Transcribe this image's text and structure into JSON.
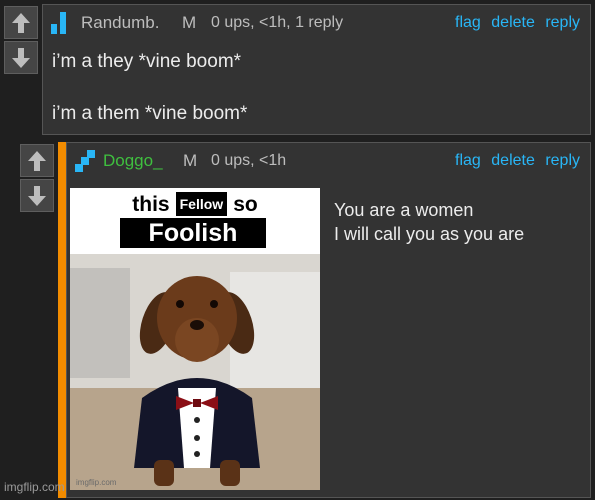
{
  "comments": [
    {
      "username": "Randumb.",
      "badge": "M",
      "meta": "0 ups, <1h, 1 reply",
      "actions": {
        "flag": "flag",
        "delete": "delete",
        "reply": "reply"
      },
      "lines": [
        "i’m a they *vine boom*",
        "i’m a them *vine boom*"
      ],
      "avatar_icon": "bar-chart-icon",
      "name_color": "#bdbdbd"
    },
    {
      "username": "Doggo_",
      "badge": "M",
      "meta": "0 ups, <1h",
      "actions": {
        "flag": "flag",
        "delete": "delete",
        "reply": "reply"
      },
      "lines": [
        "You are a women",
        "I will call you as you are"
      ],
      "avatar_icon": "diagonal-pixel-icon",
      "name_color": "#3fbf3f",
      "meme": {
        "top_word1": "this",
        "box_word": "Fellow",
        "top_word2": "so",
        "bottom_word": "Foolish",
        "watermark": "imgflip.com"
      }
    }
  ],
  "colors": {
    "background": "#1f1f1f",
    "panel": "#333333",
    "link": "#29b6f6",
    "reply_bar": "#f28c00"
  },
  "watermark": "imgflip.com"
}
